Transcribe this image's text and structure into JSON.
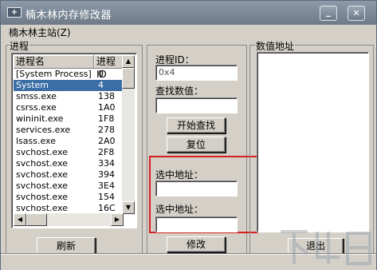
{
  "window": {
    "title": "楠木林内存修改器",
    "app_icon_glyph": "+",
    "minimize_glyph": "_",
    "close_glyph": "✕"
  },
  "menu": {
    "items": [
      {
        "label": "楠木林主站(Z)"
      }
    ]
  },
  "process_group": {
    "label": "进程",
    "columns": [
      "进程名",
      "进程ID"
    ],
    "rows": [
      {
        "name": "[System Process]",
        "pid": "0"
      },
      {
        "name": "System",
        "pid": "4",
        "selected": true
      },
      {
        "name": "smss.exe",
        "pid": "138"
      },
      {
        "name": "csrss.exe",
        "pid": "1A0"
      },
      {
        "name": "wininit.exe",
        "pid": "1F8"
      },
      {
        "name": "services.exe",
        "pid": "278"
      },
      {
        "name": "lsass.exe",
        "pid": "2A0"
      },
      {
        "name": "svchost.exe",
        "pid": "2F8"
      },
      {
        "name": "svchost.exe",
        "pid": "334"
      },
      {
        "name": "svchost.exe",
        "pid": "394"
      },
      {
        "name": "svchost.exe",
        "pid": "3E4"
      },
      {
        "name": "svchost.exe",
        "pid": "154"
      },
      {
        "name": "svchost.exe",
        "pid": "16C"
      }
    ],
    "refresh_button": "刷新"
  },
  "search_panel": {
    "process_id_label": "进程ID：",
    "process_id_value": "0x4",
    "search_value_label": "查找数值：",
    "search_value": "",
    "start_search_button": "开始查找",
    "reset_button": "复位",
    "selected_address_label_1": "选中地址：",
    "selected_address_value_1": "",
    "selected_address_label_2": "选中地址：",
    "selected_address_value_2": "",
    "modify_button": "修改"
  },
  "address_group": {
    "label": "数值地址",
    "exit_button": "退出"
  },
  "colors": {
    "highlight_box": "#d62020",
    "selection": "#3a6ea5",
    "titlebar": "#7c8998"
  }
}
